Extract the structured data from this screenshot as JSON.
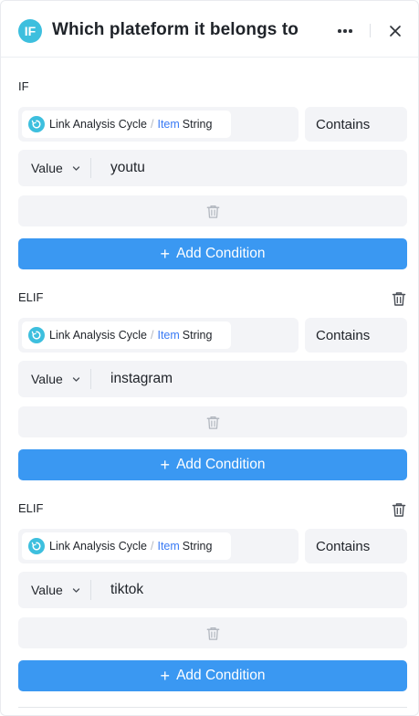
{
  "header": {
    "badge": "IF",
    "title": "Which plateform it belongs to",
    "more_icon": "ellipsis-icon",
    "close_icon": "close-icon"
  },
  "branches": [
    {
      "label": "IF",
      "deletable": false,
      "variable": {
        "node": "Link Analysis Cycle",
        "separator": "/",
        "item": "Item",
        "type": "String"
      },
      "operator": "Contains",
      "value_type": "Value",
      "value": "youtu",
      "add_label": "Add Condition"
    },
    {
      "label": "ELIF",
      "deletable": true,
      "variable": {
        "node": "Link Analysis Cycle",
        "separator": "/",
        "item": "Item",
        "type": "String"
      },
      "operator": "Contains",
      "value_type": "Value",
      "value": "instagram",
      "add_label": "Add Condition"
    },
    {
      "label": "ELIF",
      "deletable": true,
      "variable": {
        "node": "Link Analysis Cycle",
        "separator": "/",
        "item": "Item",
        "type": "String"
      },
      "operator": "Contains",
      "value_type": "Value",
      "value": "tiktok",
      "add_label": "Add Condition"
    }
  ],
  "colors": {
    "accent": "#3a98f2",
    "badge": "#3dbfde",
    "item_link": "#3a7bf5",
    "field_bg": "#f3f4f7"
  }
}
